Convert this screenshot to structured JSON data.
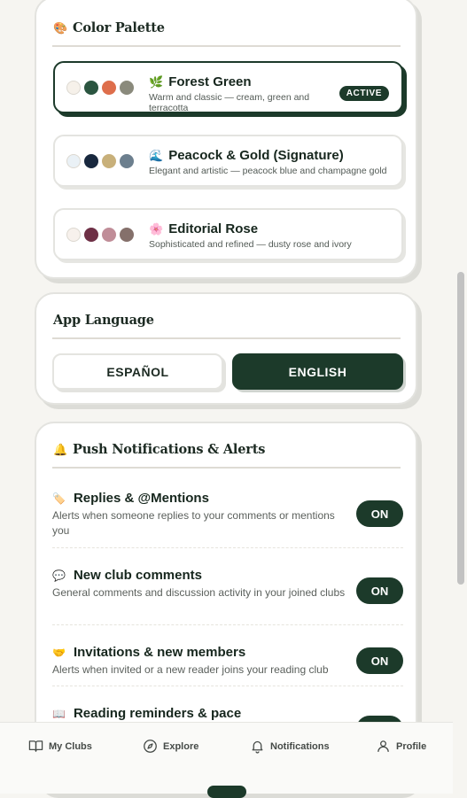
{
  "palette": {
    "title": "Color Palette",
    "title_icon": "🎨",
    "options": [
      {
        "icon": "🌿",
        "name": "Forest Green",
        "desc": "Warm and classic — cream, green and terracotta",
        "badge": "ACTIVE",
        "swatches": [
          "#f6f1ea",
          "#2b5540",
          "#de6e4b",
          "#8a8a7c"
        ]
      },
      {
        "icon": "🌊",
        "name": "Peacock & Gold (Signature)",
        "desc": "Elegant and artistic — peacock blue and champagne gold",
        "swatches": [
          "#eaf1f6",
          "#18283e",
          "#c8b07a",
          "#6c7f8e"
        ]
      },
      {
        "icon": "🌸",
        "name": "Editorial Rose",
        "desc": "Sophisticated and refined — dusty rose and ivory",
        "swatches": [
          "#f7f1ec",
          "#6e3046",
          "#c08d98",
          "#85706b"
        ]
      }
    ]
  },
  "language": {
    "title": "App Language",
    "options": [
      {
        "label": "ESPAÑOL",
        "selected": false
      },
      {
        "label": "ENGLISH",
        "selected": true
      }
    ]
  },
  "notifications": {
    "title": "Push Notifications & Alerts",
    "title_icon": "🔔",
    "items": [
      {
        "icon": "🏷️",
        "title": "Replies & @Mentions",
        "desc": "Alerts when someone replies to your comments or mentions you",
        "state": "ON"
      },
      {
        "icon": "💬",
        "title": "New club comments",
        "desc": "General comments and discussion activity in your joined clubs",
        "state": "ON"
      },
      {
        "icon": "🤝",
        "title": "Invitations & new members",
        "desc": "Alerts when invited or a new reader joins your reading club",
        "state": "ON"
      },
      {
        "icon": "📖",
        "title": "Reading reminders & pace",
        "desc": "",
        "state": "ON"
      }
    ]
  },
  "nav": {
    "items": [
      {
        "label": "My Clubs",
        "icon": "book-icon"
      },
      {
        "label": "Explore",
        "icon": "compass-icon"
      },
      {
        "label": "Notifications",
        "icon": "bell-icon"
      },
      {
        "label": "Profile",
        "icon": "user-icon"
      }
    ]
  },
  "colors": {
    "accent": "#1c3a2a",
    "background": "#f6f5f1"
  }
}
